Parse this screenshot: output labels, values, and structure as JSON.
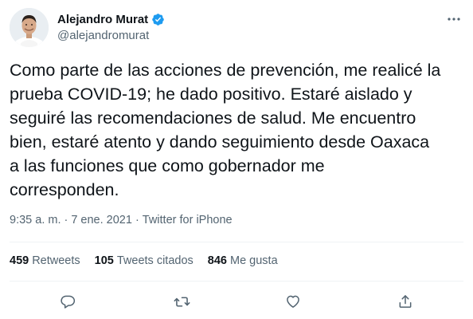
{
  "author": {
    "display_name": "Alejandro Murat",
    "handle": "@alejandromurat",
    "verified": true,
    "avatar_icon": "profile-photo"
  },
  "tweet": {
    "text": "Como parte de las acciones de prevención, me realicé la\nprueba COVID-19; he dado positivo. Estaré aislado y\nseguiré las recomendaciones de salud. Me encuentro\nbien, estaré atento y dando seguimiento desde Oaxaca\na las funciones que como gobernador me\ncorresponden."
  },
  "meta": {
    "time": "9:35 a. m.",
    "separator1": "·",
    "date": "7 ene. 2021",
    "separator2": "·",
    "source": "Twitter for iPhone"
  },
  "stats": {
    "retweets_count": "459",
    "retweets_label": "Retweets",
    "quotes_count": "105",
    "quotes_label": "Tweets citados",
    "likes_count": "846",
    "likes_label": "Me gusta"
  },
  "actions": {
    "reply_icon": "reply-icon",
    "retweet_icon": "retweet-icon",
    "like_icon": "heart-icon",
    "share_icon": "share-icon"
  },
  "colors": {
    "text_primary": "#0f1419",
    "text_secondary": "#536471",
    "verified_blue": "#1d9bf0",
    "divider": "#eff3f4"
  }
}
